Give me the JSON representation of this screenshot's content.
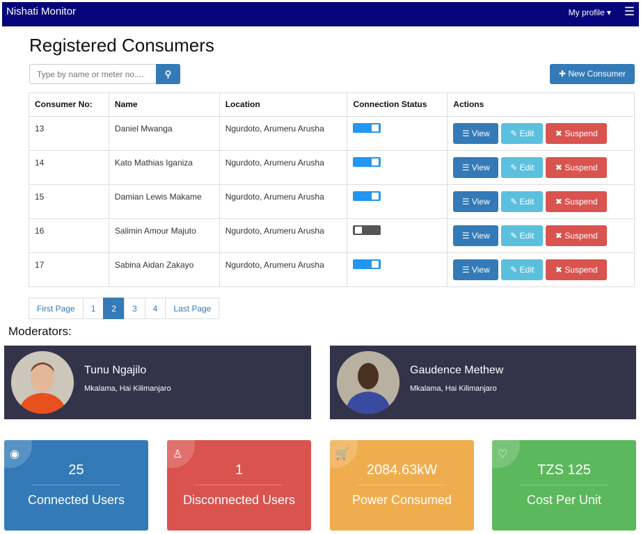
{
  "navbar": {
    "brand": "Nishati Monitor",
    "profile": "My profile ▾",
    "menu_icon": "hamburger-icon"
  },
  "page": {
    "title": "Registered Consumers",
    "search_placeholder": "Type by name or meter no....",
    "search_icon": "search-icon",
    "new_consumer_label": "✚ New Consumer"
  },
  "table": {
    "headers": [
      "Consumer No:",
      "Name",
      "Location",
      "Connection Status",
      "Actions"
    ],
    "rows": [
      {
        "no": "13",
        "name": "Daniel Mwanga",
        "location": "Ngurdoto, Arumeru Arusha",
        "connected": true
      },
      {
        "no": "14",
        "name": "Kato Mathias Iganiza",
        "location": "Ngurdoto, Arumeru Arusha",
        "connected": true
      },
      {
        "no": "15",
        "name": "Damian Lewis Makame",
        "location": "Ngurdoto, Arumeru Arusha",
        "connected": true
      },
      {
        "no": "16",
        "name": "Salimin Amour Majuto",
        "location": "Ngurdoto, Arumeru Arusha",
        "connected": false
      },
      {
        "no": "17",
        "name": "Sabina Aidan Zakayo",
        "location": "Ngurdoto, Arumeru Arusha",
        "connected": true
      }
    ],
    "actions": {
      "view": "☰ View",
      "edit": "✎ Edit",
      "suspend": "✖ Suspend"
    },
    "colors": {
      "toggle_on": "#2196f3",
      "toggle_off": "#555555"
    }
  },
  "pagination": {
    "items": [
      "First Page",
      "1",
      "2",
      "3",
      "4",
      "Last Page"
    ],
    "active": "2"
  },
  "moderators": {
    "label": "Moderators:",
    "items": [
      {
        "name": "Tunu Ngajilo",
        "location": "Mkalama, Hai Kilimanjaro"
      },
      {
        "name": "Gaudence Methew",
        "location": "Mkalama, Hai Kilimanjaro"
      }
    ]
  },
  "stats": [
    {
      "icon": "eye-icon",
      "glyph": "◉",
      "value": "25",
      "label": "Connected Users",
      "color": "#337ab7"
    },
    {
      "icon": "user-icon",
      "glyph": "♙",
      "value": "1",
      "label": "Disconnected Users",
      "color": "#d9534f"
    },
    {
      "icon": "cart-icon",
      "glyph": "🛒",
      "value": "2084.63kW",
      "label": "Power Consumed",
      "color": "#f0ad4e"
    },
    {
      "icon": "handshake-icon",
      "glyph": "♡",
      "value": "TZS 125",
      "label": "Cost Per Unit",
      "color": "#5cb85c"
    }
  ]
}
